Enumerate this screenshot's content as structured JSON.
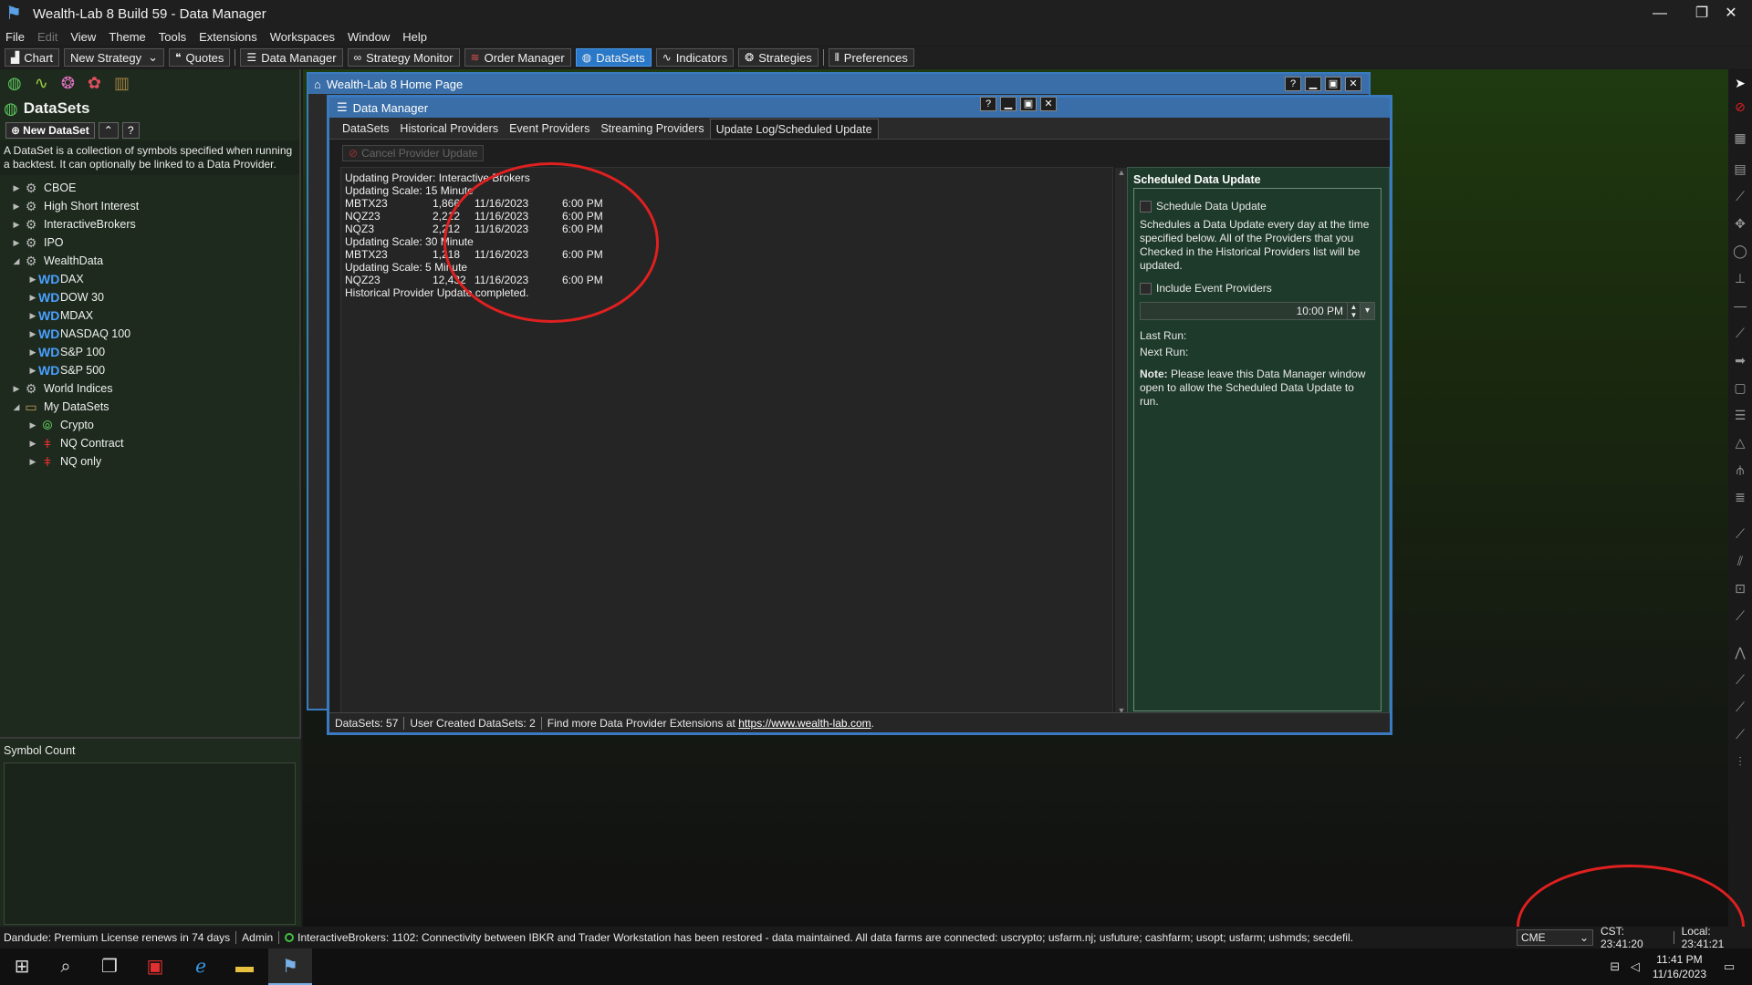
{
  "window": {
    "title": "Wealth-Lab 8 Build 59 - Data Manager",
    "controls": [
      "—",
      "❐",
      "✕"
    ]
  },
  "menu": [
    "File",
    "Edit",
    "View",
    "Theme",
    "Tools",
    "Extensions",
    "Workspaces",
    "Window",
    "Help"
  ],
  "toolbar": {
    "chart": "Chart",
    "new_strategy": "New Strategy",
    "quotes": "Quotes",
    "data_manager": "Data Manager",
    "strategy_monitor": "Strategy Monitor",
    "order_manager": "Order Manager",
    "datasets": "DataSets",
    "indicators": "Indicators",
    "strategies": "Strategies",
    "preferences": "Preferences"
  },
  "left_panel": {
    "title": "DataSets",
    "new_dataset": "New DataSet",
    "help": "?",
    "description": "A DataSet is a collection of symbols specified when running a backtest. It can optionally be linked to a Data Provider.",
    "tree": {
      "cboe": "CBOE",
      "high_short": "High Short Interest",
      "ib": "InteractiveBrokers",
      "ipo": "IPO",
      "wealthdata": "WealthData",
      "dax": "DAX",
      "dow30": "DOW 30",
      "mdax": "MDAX",
      "nasdaq100": "NASDAQ 100",
      "sp100": "S&P 100",
      "sp500": "S&P 500",
      "world": "World Indices",
      "my": "My DataSets",
      "crypto": "Crypto",
      "nq_contract": "NQ Contract",
      "nq_only": "NQ only"
    },
    "symbol_count_label": "Symbol Count"
  },
  "home_window": {
    "title": "Wealth-Lab 8 Home Page",
    "help": "?"
  },
  "data_manager": {
    "title": "Data Manager",
    "help": "?",
    "tabs": {
      "datasets": "DataSets",
      "historical": "Historical Providers",
      "event": "Event Providers",
      "streaming": "Streaming Providers",
      "update_log": "Update Log/Scheduled Update"
    },
    "cancel_button": "Cancel Provider Update",
    "log": {
      "l1": "Updating Provider: Interactive Brokers",
      "l2": "Updating Scale: 15 Minute",
      "r1": {
        "sym": "MBTX23",
        "count": "1,866",
        "date": "11/16/2023",
        "time": "6:00 PM"
      },
      "r2": {
        "sym": "NQZ23",
        "count": "2,212",
        "date": "11/16/2023",
        "time": "6:00 PM"
      },
      "r3": {
        "sym": "NQZ3",
        "count": "2,212",
        "date": "11/16/2023",
        "time": "6:00 PM"
      },
      "l3": "Updating Scale: 30 Minute",
      "r4": {
        "sym": "MBTX23",
        "count": "1,218",
        "date": "11/16/2023",
        "time": "6:00 PM"
      },
      "l4": "Updating Scale: 5 Minute",
      "r5": {
        "sym": "NQZ23",
        "count": "12,432",
        "date": "11/16/2023",
        "time": "6:00 PM"
      },
      "l5": "Historical Provider Update completed."
    },
    "scheduled": {
      "title": "Scheduled Data Update",
      "schedule_cb": "Schedule Data Update",
      "description": "Schedules a Data Update every day at the time specified below. All of the Providers that you Checked in the Historical Providers list will be updated.",
      "include_cb": "Include Event Providers",
      "time": "10:00 PM",
      "last_run": "Last Run:",
      "next_run": "Next Run:",
      "note_label": "Note:",
      "note_text": " Please leave this Data Manager window open to allow the Scheduled Data Update to run."
    },
    "status": {
      "datasets": "DataSets: 57",
      "user_created": "User Created DataSets: 2",
      "find_more": "Find more Data Provider Extensions at ",
      "link": "https://www.wealth-lab.com"
    }
  },
  "statusbar": {
    "license": "Dandude: Premium License renews in 74 days",
    "admin": "Admin",
    "message": "InteractiveBrokers: 1102: Connectivity between IBKR and Trader Workstation has been restored - data maintained. All data farms are connected: uscrypto; usfarm.nj; usfuture; cashfarm; usopt; usfarm; ushmds; secdefil.",
    "exchange": "CME",
    "cst": "CST: 23:41:20",
    "local": "Local: 23:41:21"
  },
  "taskbar": {
    "time": "11:41 PM",
    "date": "11/16/2023"
  }
}
